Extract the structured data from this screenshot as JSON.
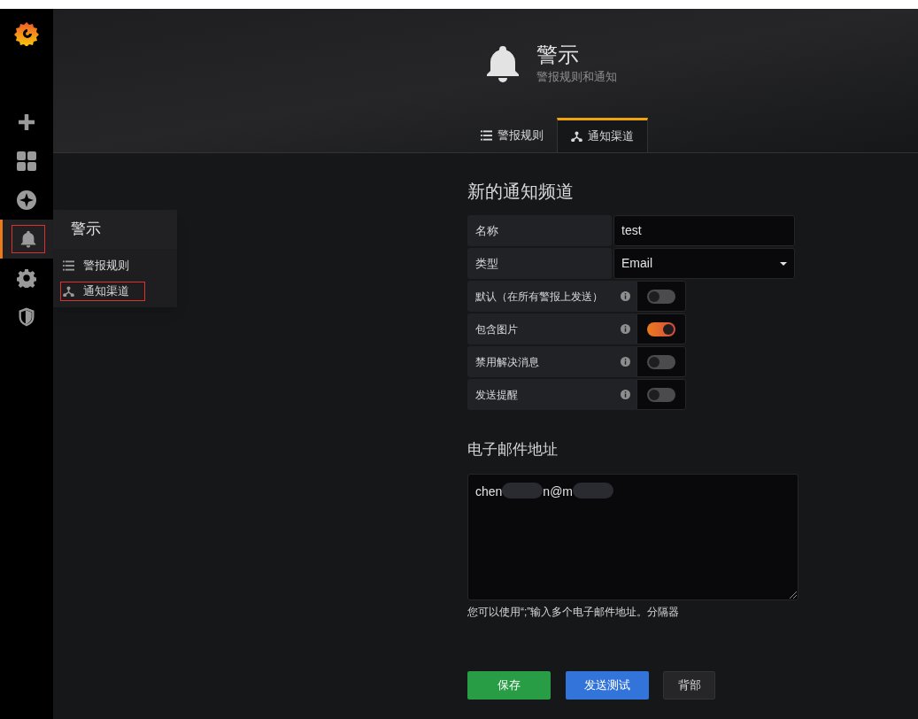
{
  "sidebar": {
    "items": [
      {
        "kind": "plus",
        "selected": false
      },
      {
        "kind": "dashboards",
        "selected": false
      },
      {
        "kind": "explore",
        "selected": false
      },
      {
        "kind": "alert",
        "selected": true
      },
      {
        "kind": "gear",
        "selected": false
      },
      {
        "kind": "shield",
        "selected": false
      }
    ]
  },
  "flyout": {
    "title": "警示",
    "items": [
      {
        "kind": "list",
        "label": "警报规则",
        "selected": false
      },
      {
        "kind": "channel",
        "label": "通知渠道",
        "selected": true
      }
    ]
  },
  "header": {
    "title": "警示",
    "subtitle": "警报规则和通知"
  },
  "tabs": [
    {
      "kind": "list",
      "label": "警报规则",
      "selected": false
    },
    {
      "kind": "channel",
      "label": "通知渠道",
      "selected": true
    }
  ],
  "form": {
    "heading": "新的通知频道",
    "fields": [
      {
        "kind": "text",
        "label": "名称",
        "value": "test"
      },
      {
        "kind": "select",
        "label": "类型",
        "value": "Email"
      }
    ],
    "switches": [
      {
        "label": "默认（在所有警报上发送）",
        "on": false
      },
      {
        "label": "包含图片",
        "on": true
      },
      {
        "label": "禁用解决消息",
        "on": false
      },
      {
        "label": "发送提醒",
        "on": false
      }
    ]
  },
  "email": {
    "heading": "电子邮件地址",
    "visible_parts": [
      "chen",
      "n@m"
    ],
    "hint": "您可以使用“;”输入多个电子邮件地址。分隔器"
  },
  "buttons": [
    {
      "kind": "primary",
      "label": "保存"
    },
    {
      "kind": "info",
      "label": "发送测试"
    },
    {
      "kind": "secondary",
      "label": "背部"
    }
  ]
}
